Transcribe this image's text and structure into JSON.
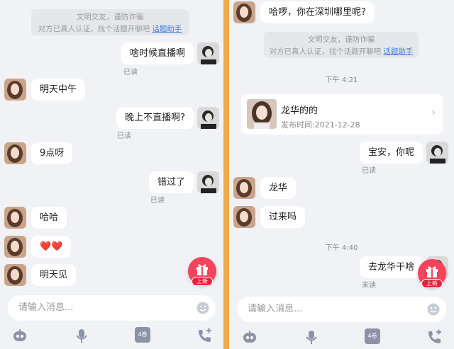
{
  "left_chat": {
    "system_notice": {
      "line1": "文明交友，谨防诈骗",
      "line2": "对方已真人认证，找个话题开聊吧",
      "link": "话题助手"
    },
    "messages": [
      {
        "from": "me",
        "text": "啥时候直播啊",
        "status": "已读"
      },
      {
        "from": "her",
        "text": "明天中午"
      },
      {
        "from": "me",
        "text": "晚上不直播啊?",
        "status": "已读"
      },
      {
        "from": "her",
        "text": "9点呀"
      },
      {
        "from": "me",
        "text": "错过了",
        "status": "已读"
      },
      {
        "from": "her",
        "text": "哈哈"
      },
      {
        "from": "her",
        "text": "❤️❤️"
      },
      {
        "from": "her",
        "text": "明天见"
      }
    ],
    "input_placeholder": "请输入消息...",
    "gift_badge": "上新",
    "toolbar": {
      "third_label": "4卷"
    }
  },
  "right_chat": {
    "messages_top": [
      {
        "from": "her",
        "text": "哈啰，你在深圳哪里呢?"
      }
    ],
    "system_notice": {
      "line1": "文明交友，谨防诈骗",
      "line2": "对方已真人认证，找个话题开聊吧",
      "link": "话题助手"
    },
    "time1": "下午 4:21",
    "card": {
      "title": "龙华的的",
      "date": "发布时间:2021-12-28",
      "chevron": "›"
    },
    "messages_mid": [
      {
        "from": "me",
        "text": "宝安，你呢",
        "status": "已读"
      },
      {
        "from": "her",
        "text": "龙华"
      },
      {
        "from": "her",
        "text": "过来吗"
      }
    ],
    "time2": "下午 4:40",
    "messages_end": [
      {
        "from": "me",
        "text": "去龙华干啥",
        "status": "未读"
      }
    ],
    "input_placeholder": "请输入消息...",
    "gift_badge": "上新",
    "toolbar": {
      "third_label": "4卷"
    }
  },
  "colors": {
    "divider": "#f0a94a",
    "background": "#f1f2f6",
    "bubble": "#ffffff",
    "link": "#3d7bd8",
    "gift": "#f4445c"
  },
  "icons": [
    "robot-icon",
    "microphone-icon",
    "coupon-icon",
    "phone-plus-icon",
    "smile-icon",
    "gift-icon",
    "chevron-right-icon"
  ]
}
